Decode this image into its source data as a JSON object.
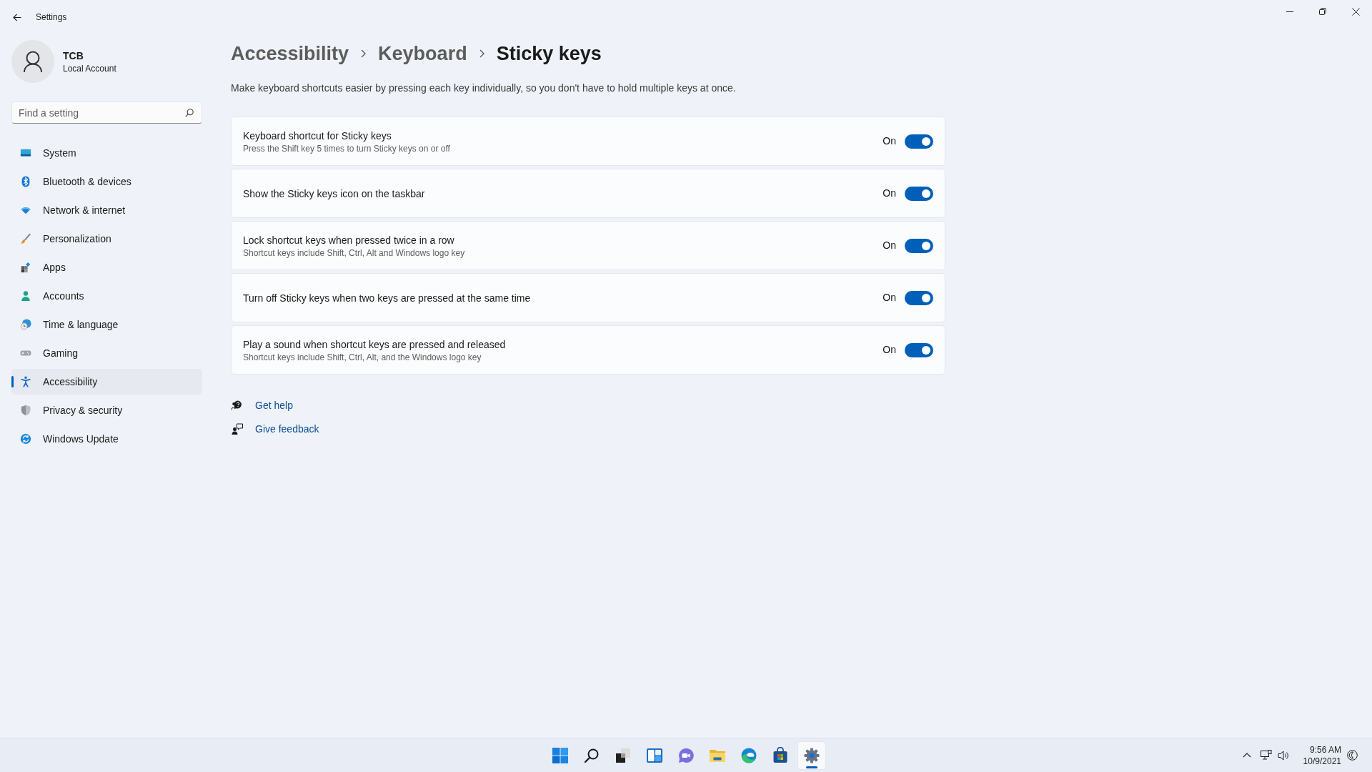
{
  "window": {
    "title": "Settings"
  },
  "account": {
    "name": "TCB",
    "type": "Local Account"
  },
  "search": {
    "placeholder": "Find a setting"
  },
  "sidebar": {
    "items": [
      {
        "label": "System",
        "selected": false
      },
      {
        "label": "Bluetooth & devices",
        "selected": false
      },
      {
        "label": "Network & internet",
        "selected": false
      },
      {
        "label": "Personalization",
        "selected": false
      },
      {
        "label": "Apps",
        "selected": false
      },
      {
        "label": "Accounts",
        "selected": false
      },
      {
        "label": "Time & language",
        "selected": false
      },
      {
        "label": "Gaming",
        "selected": false
      },
      {
        "label": "Accessibility",
        "selected": true
      },
      {
        "label": "Privacy & security",
        "selected": false
      },
      {
        "label": "Windows Update",
        "selected": false
      }
    ]
  },
  "breadcrumb": [
    "Accessibility",
    "Keyboard",
    "Sticky keys"
  ],
  "description": "Make keyboard shortcuts easier by pressing each key individually, so you don't have to hold multiple keys at once.",
  "settings": [
    {
      "title": "Keyboard shortcut for Sticky keys",
      "description": "Press the Shift key 5 times to turn Sticky keys on or off",
      "state_label": "On",
      "on": true
    },
    {
      "title": "Show the Sticky keys icon on the taskbar",
      "state_label": "On",
      "on": true
    },
    {
      "title": "Lock shortcut keys when pressed twice in a row",
      "description": "Shortcut keys include Shift, Ctrl, Alt and Windows logo key",
      "state_label": "On",
      "on": true
    },
    {
      "title": "Turn off Sticky keys when two keys are pressed at the same time",
      "state_label": "On",
      "on": true
    },
    {
      "title": "Play a sound when shortcut keys are pressed and released",
      "description": "Shortcut keys include Shift, Ctrl, Alt, and the Windows logo key",
      "state_label": "On",
      "on": true
    }
  ],
  "links": [
    "Get help",
    "Give feedback"
  ],
  "taskbar": {
    "apps": [
      {
        "selected": false
      },
      {
        "selected": false
      },
      {
        "selected": false
      },
      {
        "selected": false
      },
      {
        "selected": false
      },
      {
        "selected": false
      },
      {
        "selected": false
      },
      {
        "selected": false
      },
      {
        "selected": true
      }
    ]
  },
  "tray": {
    "time": "9:56 AM",
    "date": "10/9/2021"
  }
}
